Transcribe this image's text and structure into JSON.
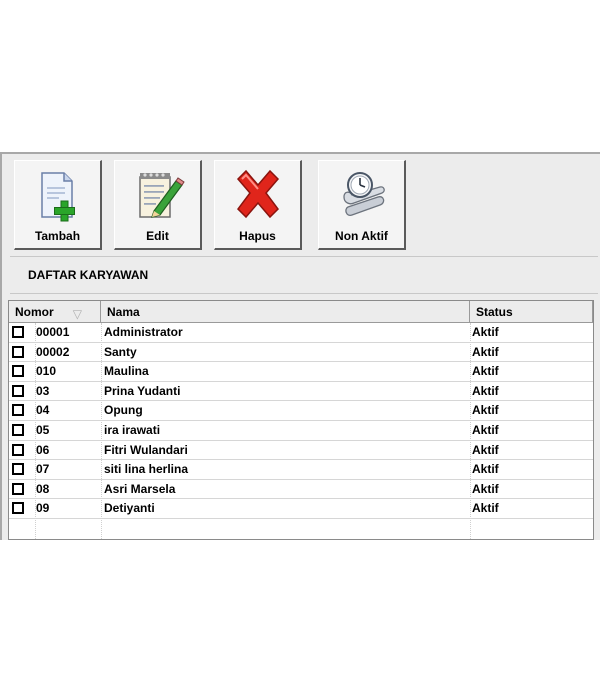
{
  "toolbar": {
    "buttons": [
      {
        "label": "Tambah",
        "icon": "document-add-icon"
      },
      {
        "label": "Edit",
        "icon": "notepad-pencil-icon"
      },
      {
        "label": "Hapus",
        "icon": "red-x-icon"
      },
      {
        "label": "Non Aktif",
        "icon": "clock-scroll-icon"
      }
    ]
  },
  "section": {
    "title": "DAFTAR KARYAWAN"
  },
  "table": {
    "columns": [
      "Nomor",
      "Nama",
      "Status"
    ],
    "rows": [
      {
        "nomor": "00001",
        "nama": "Administrator",
        "status": "Aktif",
        "checked": false
      },
      {
        "nomor": "00002",
        "nama": "Santy",
        "status": "Aktif",
        "checked": false
      },
      {
        "nomor": "010",
        "nama": "Maulina",
        "status": "Aktif",
        "checked": false
      },
      {
        "nomor": "03",
        "nama": "Prina Yudanti",
        "status": "Aktif",
        "checked": false
      },
      {
        "nomor": "04",
        "nama": "Opung",
        "status": "Aktif",
        "checked": false
      },
      {
        "nomor": "05",
        "nama": "ira irawati",
        "status": "Aktif",
        "checked": false
      },
      {
        "nomor": "06",
        "nama": "Fitri Wulandari",
        "status": "Aktif",
        "checked": false
      },
      {
        "nomor": "07",
        "nama": "siti lina herlina",
        "status": "Aktif",
        "checked": false
      },
      {
        "nomor": "08",
        "nama": "Asri Marsela",
        "status": "Aktif",
        "checked": false
      },
      {
        "nomor": "09",
        "nama": "Detiyanti",
        "status": "Aktif",
        "checked": false
      }
    ]
  },
  "colors": {
    "panel": "#ececec",
    "delete_red": "#e0251b",
    "add_green": "#2aa52a"
  }
}
